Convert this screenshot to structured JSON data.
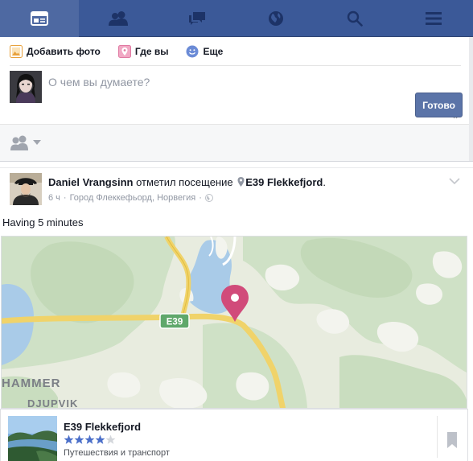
{
  "topnav": {
    "tabs": [
      {
        "icon": "news-feed-icon",
        "active": true
      },
      {
        "icon": "friend-requests-icon",
        "active": false
      },
      {
        "icon": "messages-icon",
        "active": false
      },
      {
        "icon": "notifications-globe-icon",
        "active": false
      },
      {
        "icon": "search-icon",
        "active": false
      },
      {
        "icon": "menu-icon",
        "active": false
      }
    ],
    "bar_color": "#3b5998"
  },
  "composer": {
    "add_photo_label": "Добавить фото",
    "where_label": "Где вы",
    "more_label": "Еще",
    "placeholder": "О чем вы думаете?",
    "done_label": "Готово"
  },
  "story": {
    "actor": "Daniel Vrangsinn",
    "verb": "отметил посещение",
    "place": "E39 Flekkefjord",
    "period": ".",
    "time": "6 ч",
    "separator": "·",
    "location": "Город Флеккефьорд, Норвегия",
    "text": "Having 5 minutes",
    "map": {
      "road_shield": "E39",
      "labels": [
        "HAMMER",
        "DJUPVIK"
      ],
      "pin_color": "#d14b7a"
    },
    "place_card": {
      "name": "E39 Flekkefjord",
      "rating": 4,
      "rating_max": 5,
      "category": "Путешествия и транспорт"
    }
  }
}
